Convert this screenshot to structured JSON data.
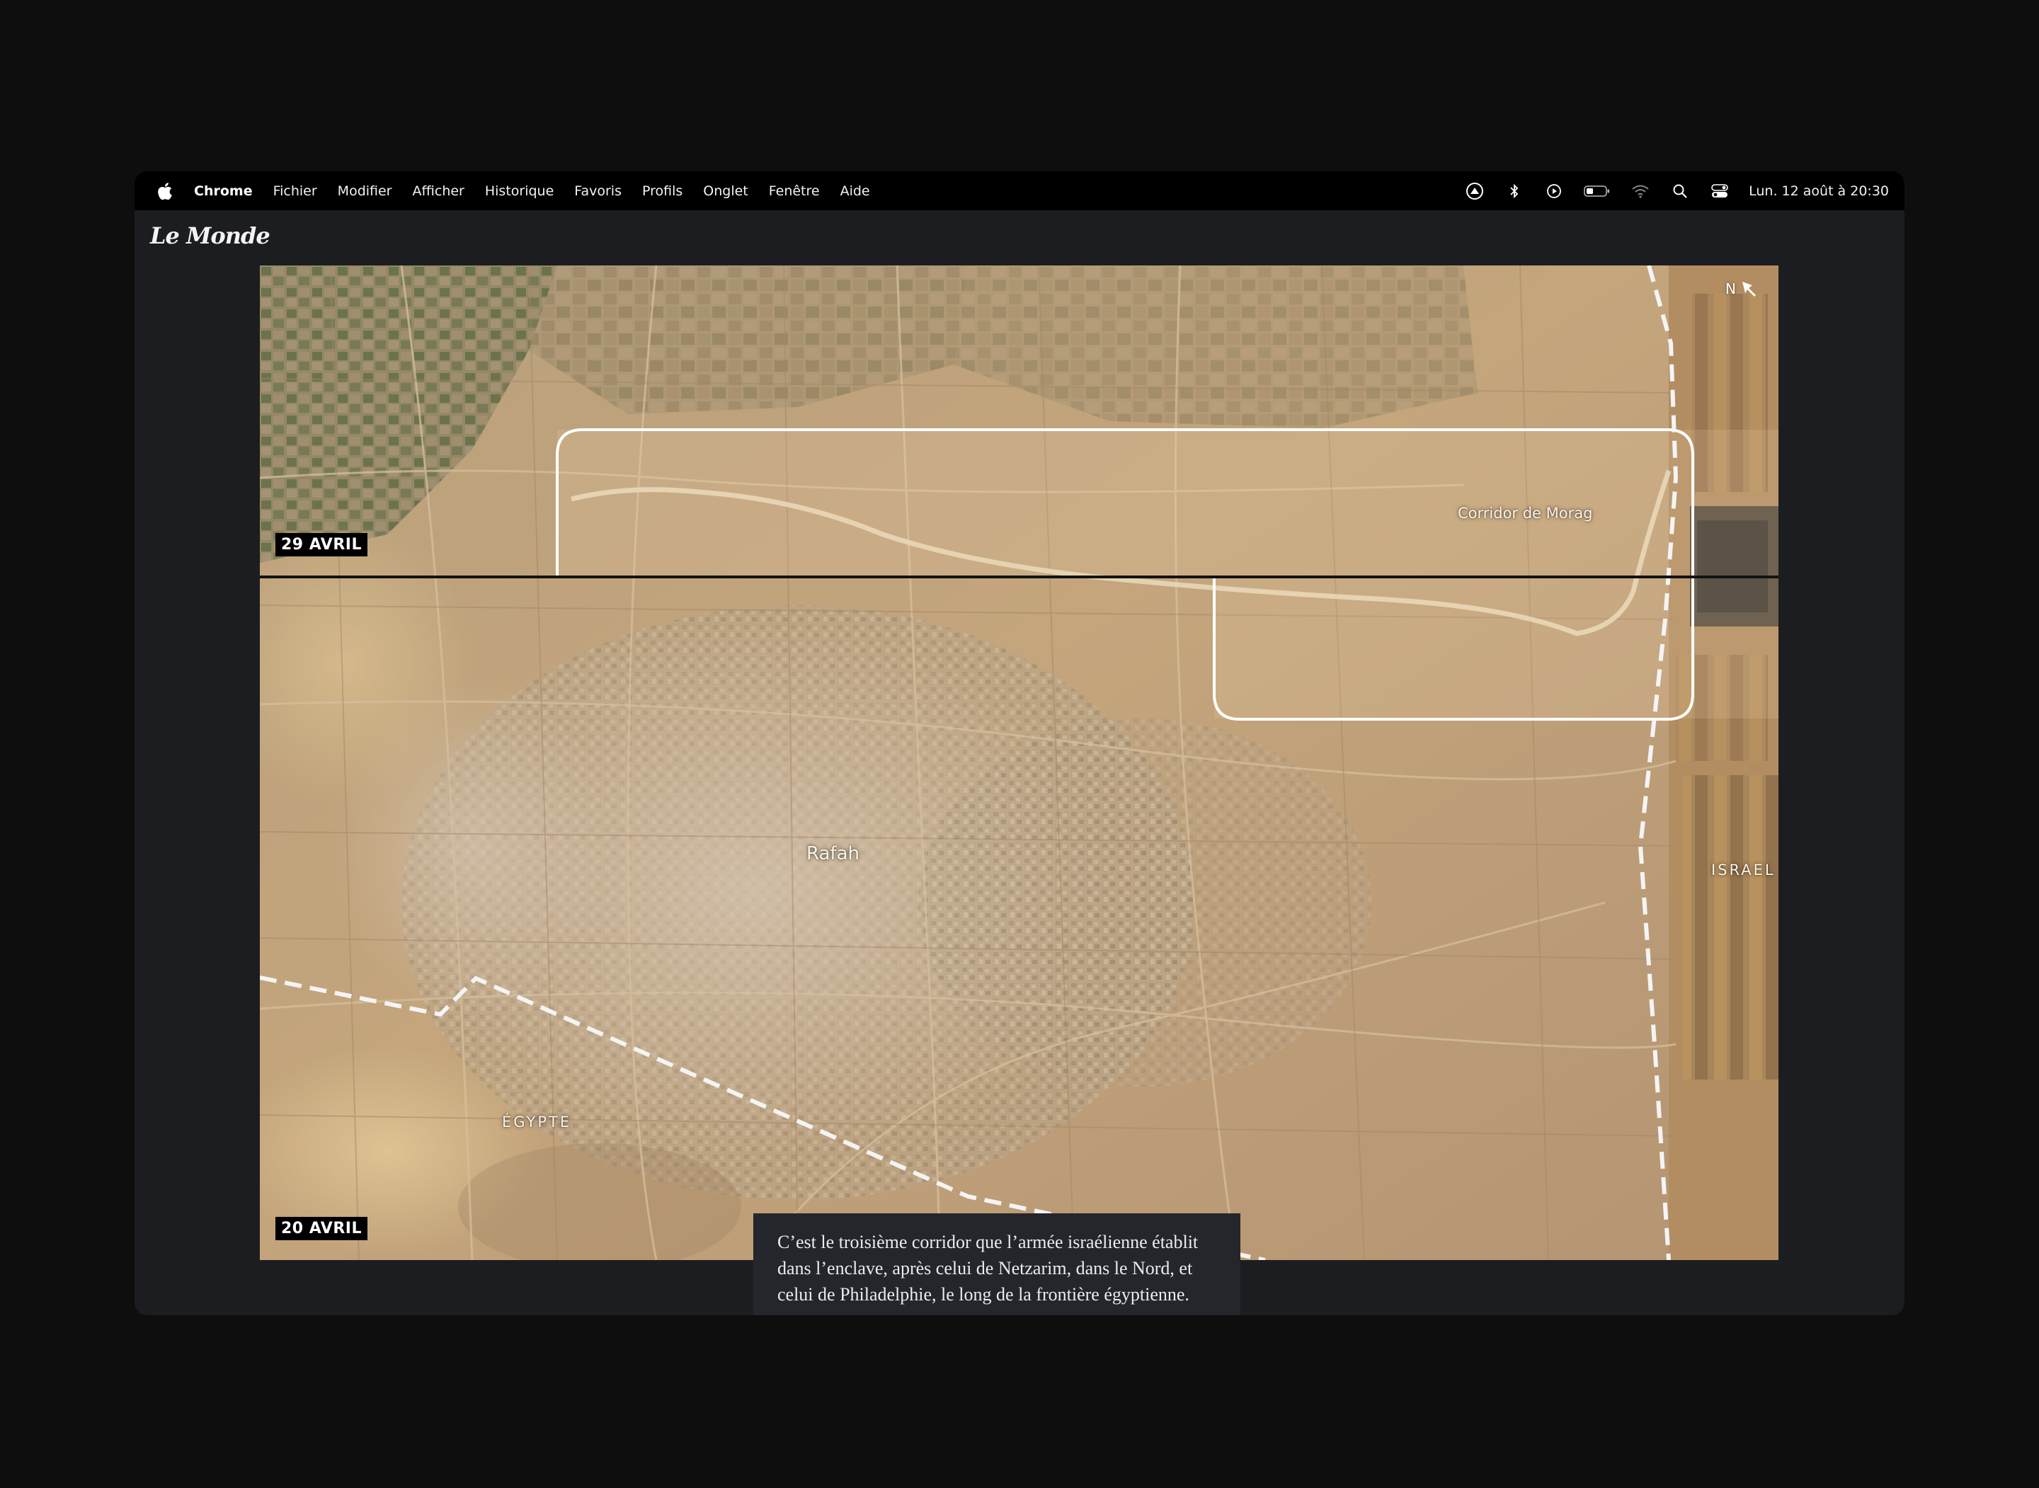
{
  "menubar": {
    "apple_icon": "apple-icon",
    "app_name": "Chrome",
    "items": [
      "Fichier",
      "Modifier",
      "Afficher",
      "Historique",
      "Favoris",
      "Profils",
      "Onglet",
      "Fenêtre",
      "Aide"
    ],
    "status_icons": [
      "focus-icon",
      "bluetooth-icon",
      "play-icon",
      "battery-icon",
      "wifi-icon",
      "search-icon",
      "control-center-icon"
    ],
    "clock": "Lun. 12 août à  20:30"
  },
  "site": {
    "logo": "Le Monde"
  },
  "map": {
    "date_top": "29 AVRIL",
    "date_bottom": "20 AVRIL",
    "north_label": "N",
    "labels": {
      "rafah": "Rafah",
      "corridor": "Corridor de Morag",
      "israel": "ISRAEL",
      "egypte": "ÉGYPTE"
    },
    "colors": {
      "sand": "#c9a87c",
      "border_line": "#f4f4f4",
      "highlight": "#ffffff"
    }
  },
  "caption": {
    "text": "C’est le troisième corridor que l’armée israélienne établit dans l’enclave, après celui de Netzarim, dans le Nord, et celui de Philadelphie, le long de la frontière égyptienne."
  }
}
